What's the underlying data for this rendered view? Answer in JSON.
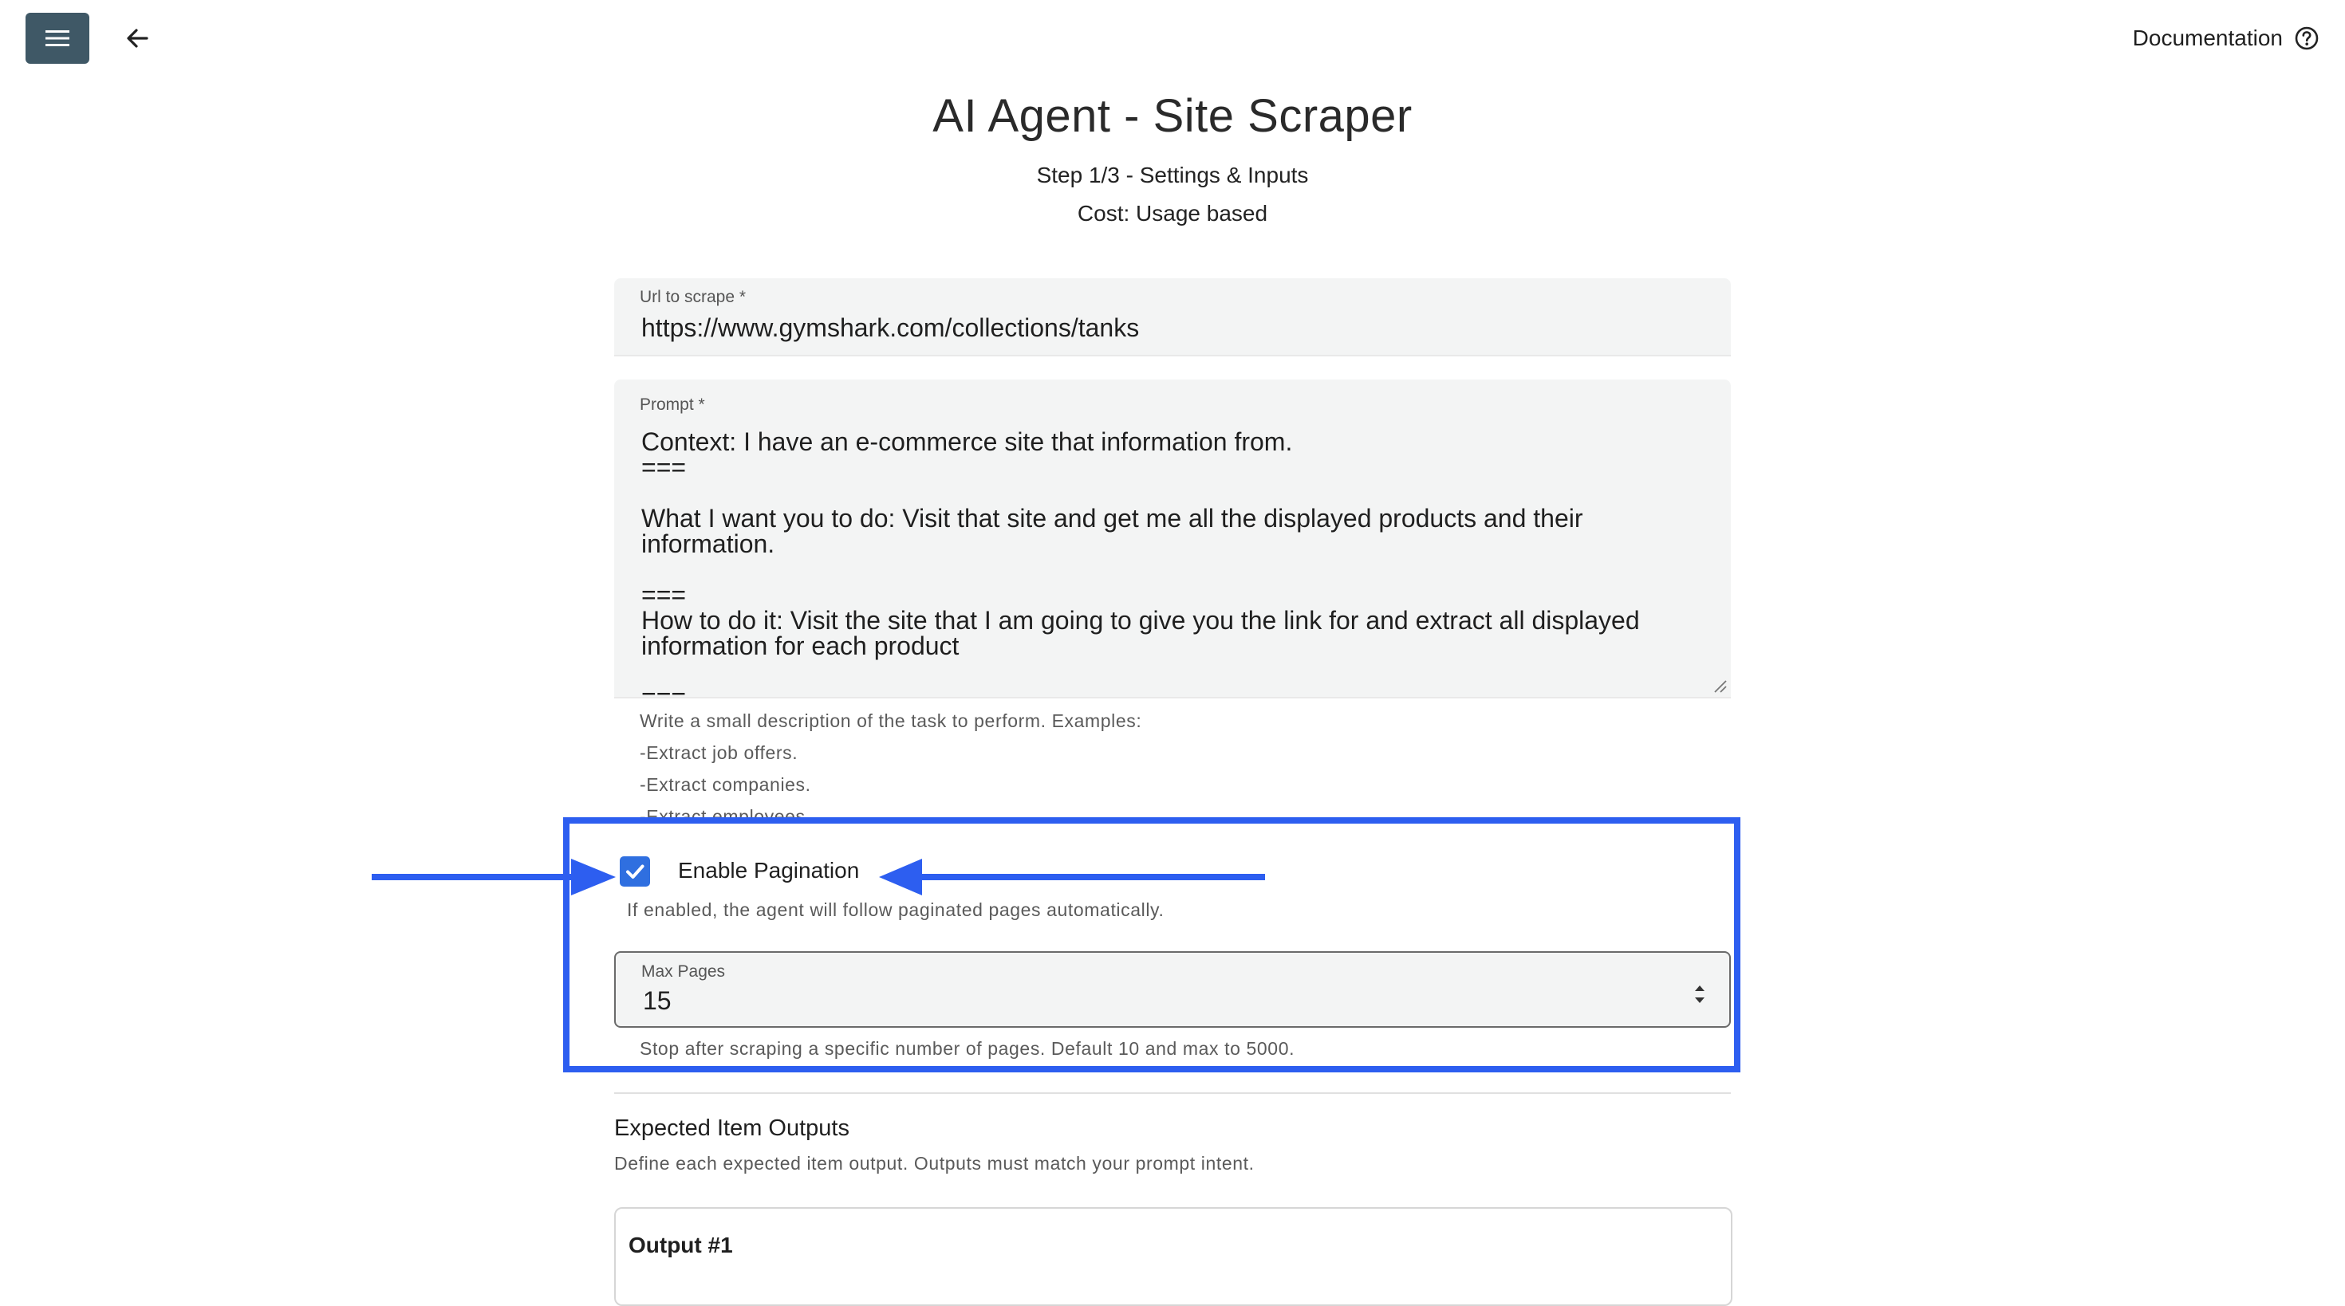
{
  "topbar": {
    "menu_icon": "hamburger-menu-icon",
    "back_icon": "arrow-left-icon",
    "documentation_label": "Documentation",
    "help_icon": "help-circle-icon"
  },
  "header": {
    "title": "AI Agent - Site Scraper",
    "step": "Step 1/3 - Settings & Inputs",
    "cost": "Cost: Usage based"
  },
  "form": {
    "url": {
      "label": "Url to scrape *",
      "value": "https://www.gymshark.com/collections/tanks"
    },
    "prompt": {
      "label": "Prompt *",
      "value": "Context: I have an e-commerce site that information from.\n===\n\nWhat I want you to do: Visit that site and get me all the displayed products and their information.\n\n===\nHow to do it: Visit the site that I am going to give you the link for and extract all displayed information for each product\n\n===",
      "helper_lines": [
        "Write a small description of the task to perform. Examples:",
        "-Extract job offers.",
        "-Extract companies.",
        "-Extract employees."
      ]
    },
    "pagination": {
      "checked": true,
      "label": "Enable Pagination",
      "helper": "If enabled, the agent will follow paginated pages automatically."
    },
    "max_pages": {
      "label": "Max Pages",
      "value": "15",
      "helper": "Stop after scraping a specific number of pages. Default 10 and max to 5000."
    }
  },
  "outputs": {
    "title": "Expected Item Outputs",
    "description": "Define each expected item output. Outputs must match your prompt intent.",
    "items": [
      {
        "title": "Output #1"
      }
    ]
  },
  "annotation": {
    "highlight_color": "#2d5ef0"
  },
  "colors": {
    "menu_button_bg": "#3f5866",
    "checkbox_accent": "#2f6fe0",
    "field_bg": "#f3f4f4"
  }
}
